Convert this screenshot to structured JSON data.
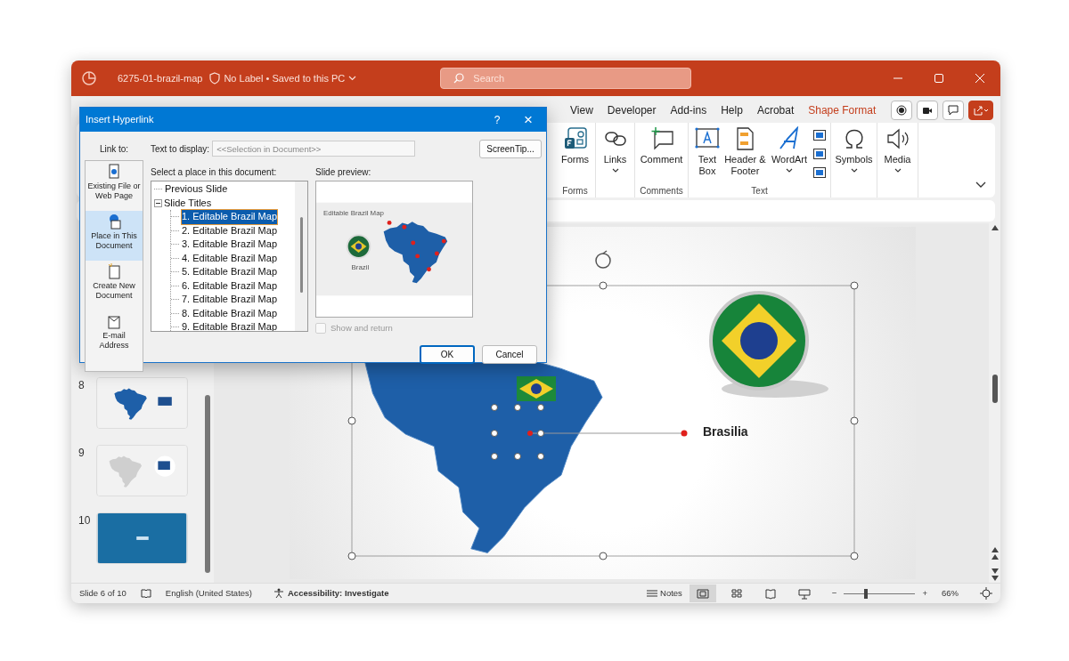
{
  "window": {
    "file_name": "6275-01-brazil-map",
    "status": "No Label • Saved to this PC"
  },
  "search": {
    "placeholder": "Search"
  },
  "menu_tabs": [
    {
      "label": "View",
      "selected": false
    },
    {
      "label": "Developer",
      "selected": false
    },
    {
      "label": "Add-ins",
      "selected": false
    },
    {
      "label": "Help",
      "selected": false
    },
    {
      "label": "Acrobat",
      "selected": false
    },
    {
      "label": "Shape Format",
      "selected": true
    }
  ],
  "ribbon": {
    "groups": [
      {
        "label": "Forms",
        "buttons": [
          {
            "label": "Forms",
            "dropdown": false
          }
        ]
      },
      {
        "buttons": [
          {
            "label": "Links",
            "dropdown": true
          }
        ]
      },
      {
        "label": "Comments",
        "buttons": [
          {
            "label": "Comment",
            "dropdown": false
          }
        ]
      },
      {
        "label": "Text",
        "buttons": [
          {
            "label": "Text Box",
            "dropdown": false
          },
          {
            "label": "Header & Footer",
            "dropdown": false
          },
          {
            "label": "WordArt",
            "dropdown": true
          }
        ]
      },
      {
        "buttons": [
          {
            "label": "Symbols",
            "dropdown": true
          }
        ]
      },
      {
        "buttons": [
          {
            "label": "Media",
            "dropdown": true
          }
        ]
      }
    ]
  },
  "thumbnails": [
    {
      "number": "8",
      "selected": false
    },
    {
      "number": "9",
      "selected": false
    },
    {
      "number": "10",
      "selected": false
    }
  ],
  "slide": {
    "city_label": "Brasilia"
  },
  "dialog": {
    "title": "Insert Hyperlink",
    "help": "?",
    "close": "×",
    "link_to_label": "Link to:",
    "link_options": [
      {
        "label": "Existing File or Web Page",
        "selected": false
      },
      {
        "label": "Place in This Document",
        "selected": true
      },
      {
        "label": "Create New Document",
        "selected": false
      },
      {
        "label": "E-mail Address",
        "selected": false
      }
    ],
    "text_to_display": {
      "label": "Text to display:",
      "value": "<<Selection in Document>>"
    },
    "screentip": "ScreenTip...",
    "place_label": "Select a place in this document:",
    "places": [
      {
        "label": "Previous Slide",
        "selected": false
      },
      {
        "label": "Slide Titles",
        "selected": false,
        "expanded": true,
        "children": [
          {
            "label": "1. Editable Brazil Map",
            "selected": true
          },
          {
            "label": "2. Editable Brazil Map",
            "selected": false
          },
          {
            "label": "3. Editable Brazil Map",
            "selected": false
          },
          {
            "label": "4. Editable Brazil Map",
            "selected": false
          },
          {
            "label": "5. Editable Brazil Map",
            "selected": false
          },
          {
            "label": "6. Editable Brazil Map",
            "selected": false
          },
          {
            "label": "7. Editable Brazil Map",
            "selected": false
          },
          {
            "label": "8. Editable Brazil Map",
            "selected": false
          },
          {
            "label": "9. Editable Brazil Map",
            "selected": false
          }
        ]
      }
    ],
    "preview_label": "Slide preview:",
    "preview": {
      "title": "Editable Brazil Map",
      "caption": "Brazil"
    },
    "show_and_return": {
      "label": "Show and return",
      "checked": false,
      "disabled": true
    },
    "buttons": [
      {
        "label": "OK",
        "default": true
      },
      {
        "label": "Cancel",
        "default": false
      }
    ]
  },
  "status_bar": {
    "slide_count": "Slide 6 of 10",
    "language": "English (United States)",
    "accessibility": "Accessibility: Investigate",
    "notes": "Notes",
    "views": [
      {
        "selected": true
      },
      {
        "selected": false
      },
      {
        "selected": false
      },
      {
        "selected": false
      }
    ],
    "zoom_out": "−",
    "zoom_in": "+",
    "zoom": {
      "level": 0.31,
      "reading": "66%"
    }
  }
}
